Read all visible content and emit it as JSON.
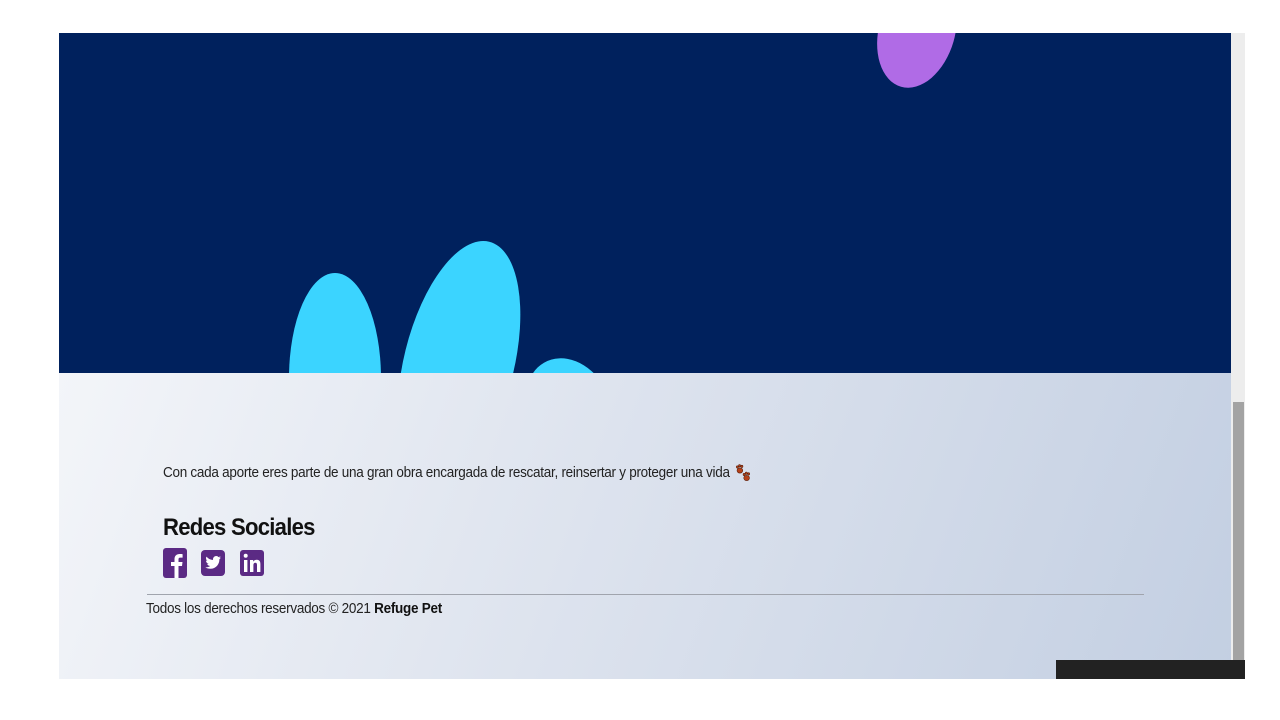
{
  "footer": {
    "tagline": "Con cada aporte eres parte de una gran obra encargada de rescatar, reinsertar y proteger una vida",
    "tagline_icon": "paw-prints-icon",
    "social_title": "Redes Sociales",
    "social_icons": [
      "facebook-icon",
      "twitter-icon",
      "linkedin-icon"
    ],
    "copyright_text": "Todos los derechos reservados © 2021",
    "brand_name": "Refuge Pet"
  },
  "colors": {
    "hero_background": "#00215d",
    "blob_cyan": "#3bd4ff",
    "blob_purple": "#b06be6",
    "social_icon": "#5b2a84"
  }
}
